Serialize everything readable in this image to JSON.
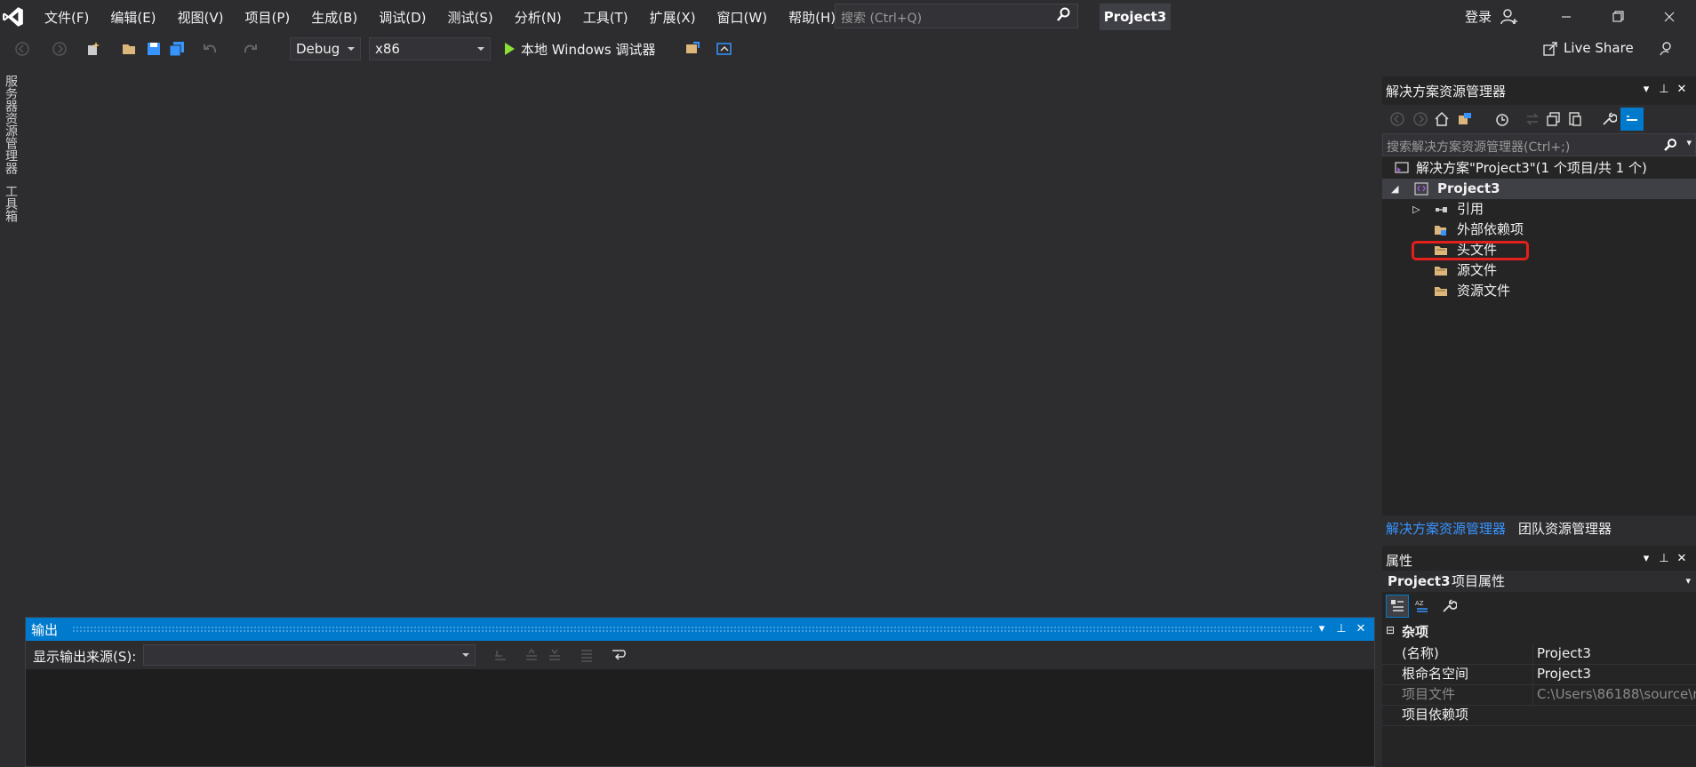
{
  "title_bar": {
    "menu": [
      "文件(F)",
      "编辑(E)",
      "视图(V)",
      "项目(P)",
      "生成(B)",
      "调试(D)",
      "测试(S)",
      "分析(N)",
      "工具(T)",
      "扩展(X)",
      "窗口(W)",
      "帮助(H)"
    ],
    "search_placeholder": "搜索 (Ctrl+Q)",
    "project_name": "Project3",
    "login": "登录"
  },
  "toolbar": {
    "configuration": "Debug",
    "platform": "x86",
    "run_target": "本地 Windows 调试器",
    "live_share": "Live Share"
  },
  "side_tabs": [
    "服务器资源管理器",
    "工具箱"
  ],
  "output": {
    "title": "输出",
    "source_label": "显示输出来源(S):",
    "source_value": ""
  },
  "solution_explorer": {
    "title": "解决方案资源管理器",
    "search_placeholder": "搜索解决方案资源管理器(Ctrl+;)",
    "solution": "解决方案\"Project3\"(1 个项目/共 1 个)",
    "project": "Project3",
    "nodes": [
      "引用",
      "外部依赖项",
      "头文件",
      "源文件",
      "资源文件"
    ],
    "tabs": [
      "解决方案资源管理器",
      "团队资源管理器"
    ]
  },
  "properties": {
    "title": "属性",
    "object_name": "Project3",
    "object_type": "项目属性",
    "category": "杂项",
    "rows": [
      {
        "name": "(名称)",
        "value": "Project3"
      },
      {
        "name": "根命名空间",
        "value": "Project3"
      },
      {
        "name": "项目文件",
        "value": "C:\\Users\\86188\\source\\r"
      },
      {
        "name": "项目依赖项",
        "value": ""
      }
    ]
  },
  "colors": {
    "accent": "#007acc",
    "highlight": "#e3201b",
    "folder": "#dcb67a",
    "run": "#8ae234"
  }
}
